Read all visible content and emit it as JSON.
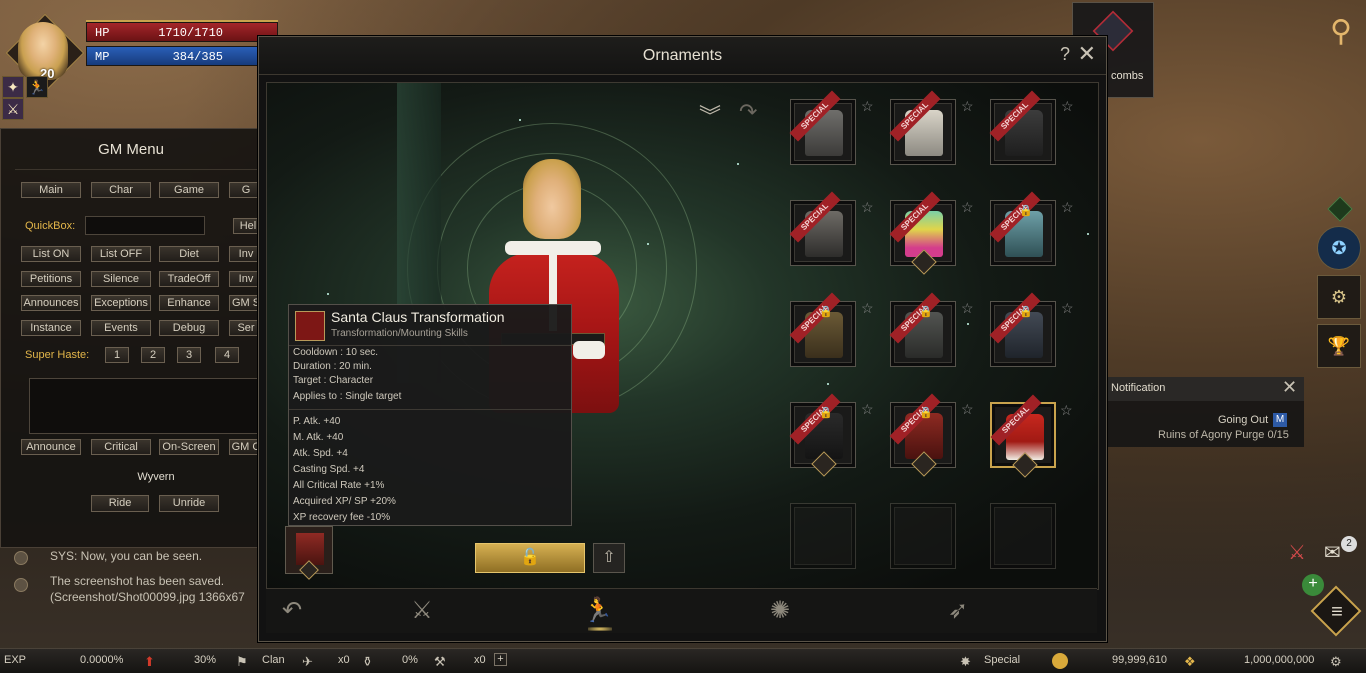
{
  "status": {
    "hp_label": "HP",
    "hp_value": "1710/1710",
    "mp_label": "MP",
    "mp_value": "384/385",
    "level": "20"
  },
  "gm_menu": {
    "title": "GM Menu",
    "tabs": [
      "Main",
      "Char",
      "Game",
      "G"
    ],
    "quickbox_label": "QuickBox:",
    "help_label": "Hel",
    "row1": [
      "List ON",
      "List OFF",
      "Diet",
      "Inv"
    ],
    "row2": [
      "Petitions",
      "Silence",
      "TradeOff",
      "Inv"
    ],
    "row3": [
      "Announces",
      "Exceptions",
      "Enhance",
      "GM S"
    ],
    "row4": [
      "Instance",
      "Events",
      "Debug",
      "Ser"
    ],
    "super_haste_label": "Super Haste:",
    "haste_levels": [
      "1",
      "2",
      "3",
      "4"
    ],
    "row5": [
      "Announce",
      "Critical",
      "On-Screen",
      "GM C"
    ],
    "wyvern_label": "Wyvern",
    "ride_label": "Ride",
    "unride_label": "Unride"
  },
  "chat": {
    "line1": "SYS: Now, you can be seen.",
    "line2": "The screenshot has been saved.",
    "line3": "(Screenshot/Shot00099.jpg 1366x67"
  },
  "ornaments": {
    "title": "Ornaments",
    "help_icon": "?",
    "close_icon": "✕",
    "ribbon_text": "SPECIAL",
    "tooltip": {
      "name": "Santa Claus Transformation",
      "category": "Transformation/Mounting Skills",
      "info": [
        "Cooldown : 10 sec.",
        "Duration : 20 min.",
        "Target : Character",
        "Applies to : Single target"
      ],
      "stats": [
        "P. Atk. +40",
        "M. Atk. +40",
        "Atk. Spd. +4",
        "Casting Spd. +4",
        "All Critical Rate +1%",
        "Acquired XP/ SP +20%",
        "XP recovery fee -10%"
      ]
    },
    "unlock_icon": "🔓",
    "share_icon": "⇧",
    "tab_icons": [
      "back-arrow-icon",
      "sword-icon",
      "transform-icon",
      "agathion-icon",
      "horn-icon"
    ]
  },
  "right_panel": {
    "catacombs_label": "combs",
    "notification_title": "Notification",
    "quest_name": "Going Out",
    "quest_badge": "M",
    "quest_progress": "Ruins of Agony Purge 0/15",
    "mail_count": "2"
  },
  "bottom_bar": {
    "exp_label": "EXP",
    "exp_value": "0.0000%",
    "vitality_value": "30%",
    "clan_label": "Clan",
    "count1": "x0",
    "percent2": "0%",
    "count2": "x0",
    "plus": "+",
    "special_label": "Special",
    "adena": "99,999,610",
    "lcoin": "1,000,000,000"
  },
  "colors": {
    "accent_gold": "#c9a34d",
    "hp_red": "#a4262a",
    "mp_blue": "#2a5fb8",
    "special_ribbon": "#a02126"
  }
}
